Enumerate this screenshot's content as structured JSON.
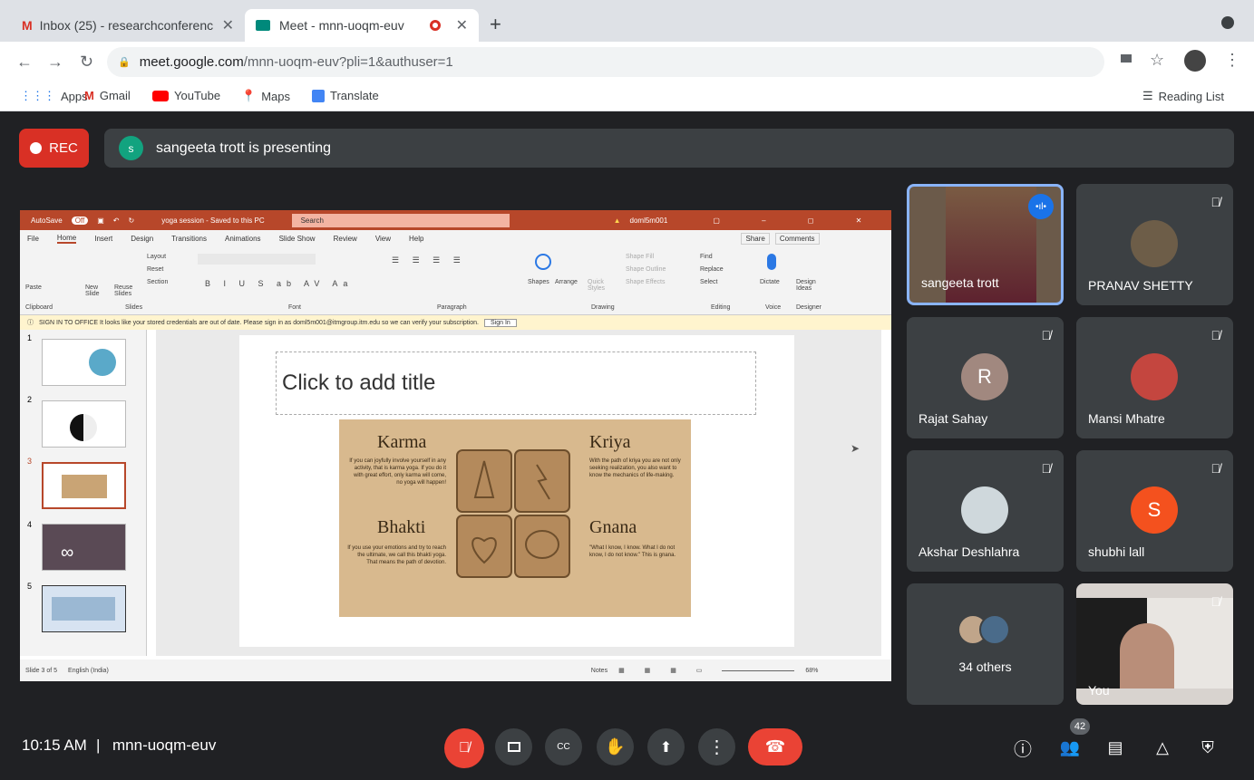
{
  "browser": {
    "tabs": [
      {
        "title": "Inbox (25) - researchconferenc"
      },
      {
        "title": "Meet - mnn-uoqm-euv"
      }
    ],
    "url_host": "meet.google.com",
    "url_path": "/mnn-uoqm-euv?pli=1&authuser=1",
    "bookmarks": [
      "Apps",
      "Gmail",
      "YouTube",
      "Maps",
      "Translate"
    ],
    "reading_list": "Reading List"
  },
  "meet": {
    "rec_label": "REC",
    "presenter_initial": "s",
    "presenting_text": "sangeeta trott is presenting",
    "time": "10:15 AM",
    "separator": "|",
    "meeting_code": "mnn-uoqm-euv",
    "participants_count": "42",
    "participants": [
      {
        "name": "sangeeta trott"
      },
      {
        "name": "PRANAV SHETTY"
      },
      {
        "name": "Rajat Sahay",
        "initial": "R",
        "color": "#a1887f"
      },
      {
        "name": "Mansi Mhatre"
      },
      {
        "name": "Akshar Deshlahra"
      },
      {
        "name": "shubhi lall",
        "initial": "S",
        "color": "#f4511e"
      },
      {
        "name": "34 others"
      },
      {
        "name": "You"
      }
    ]
  },
  "ppt": {
    "autosave": "AutoSave",
    "autosave_state": "Off",
    "doc_title": "yoga session - Saved to this PC",
    "search": "Search",
    "user": "doml5m001",
    "menu": [
      "File",
      "Home",
      "Insert",
      "Design",
      "Transitions",
      "Animations",
      "Slide Show",
      "Review",
      "View",
      "Help"
    ],
    "share": "Share",
    "comments": "Comments",
    "ribbon_groups": [
      "Clipboard",
      "Slides",
      "Font",
      "Paragraph",
      "Drawing",
      "Editing",
      "Voice",
      "Designer"
    ],
    "ribbon_items": [
      "Paste",
      "New Slide",
      "Reuse Slides",
      "Layout",
      "Reset",
      "Section",
      "Shapes",
      "Arrange",
      "Quick Styles",
      "Shape Fill",
      "Shape Outline",
      "Shape Effects",
      "Find",
      "Replace",
      "Select",
      "Dictate",
      "Design Ideas"
    ],
    "signin_text": "SIGN IN TO OFFICE  It looks like your stored credentials are out of date. Please sign in as doml5m001@itmgroup.itm.edu so we can verify your subscription.",
    "signin_button": "Sign In",
    "slide_numbers": [
      "1",
      "2",
      "3",
      "4",
      "5"
    ],
    "slide_title_placeholder": "Click to add title",
    "status": "Slide 3 of 5",
    "language": "English (India)",
    "notes": "Notes",
    "zoom": "68%",
    "yoga": {
      "karma_title": "Karma",
      "karma_text": "If you can joyfully involve yourself in any activity, that is karma yoga. If you do it with great effort, only karma will come, no yoga will happen!",
      "kriya_title": "Kriya",
      "kriya_text": "With the path of kriya you are not only seeking realization, you also want to know the mechanics of life-making.",
      "bhakti_title": "Bhakti",
      "bhakti_text": "If you use your emotions and try to reach the ultimate, we call this bhakti yoga. That means the path of devotion.",
      "gnana_title": "Gnana",
      "gnana_text": "\"What I know, I know. What I do not know, I do not know.\" This is gnana."
    }
  }
}
